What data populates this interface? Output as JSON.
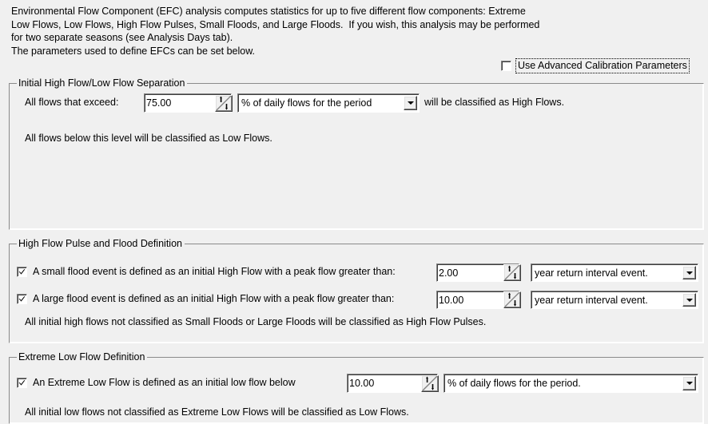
{
  "intro": {
    "text": "Environmental Flow Component (EFC) analysis computes statistics for up to five different flow components: Extreme\nLow Flows, Low Flows, High Flow Pulses, Small Floods, and Large Floods.  If you wish, this analysis may be performed\nfor two separate seasons (see Analysis Days tab).\nThe parameters used to define EFCs can be set below."
  },
  "advanced": {
    "label": "Use Advanced Calibration Parameters",
    "checked": false
  },
  "separation_group": {
    "title": "Initial High Flow/Low Flow Separation",
    "exceed_label": "All flows that exceed:",
    "exceed_value": "75.00",
    "exceed_unit": "% of daily flows for the period",
    "classified_label": "will be classified as High Flows.",
    "note": "All flows below this level will be classified as Low Flows."
  },
  "flood_group": {
    "title": "High Flow Pulse and Flood Definition",
    "small_flood_label": "A small flood event is defined as an initial High Flow with a peak flow greater than:",
    "small_flood_value": "2.00",
    "small_flood_unit": "year return interval event.",
    "large_flood_label": "A large flood event is defined as an initial High Flow with a peak flow greater than:",
    "large_flood_value": "10.00",
    "large_flood_unit": "year return interval event.",
    "note": "All initial high flows not classified as Small Floods or Large Floods will be classified as High Flow Pulses."
  },
  "extreme_group": {
    "title": "Extreme Low Flow Definition",
    "extreme_label": "An Extreme Low Flow is defined as an initial low flow below",
    "extreme_value": "10.00",
    "extreme_unit": "% of daily flows for the period.",
    "note": "All initial low flows not classified as Extreme Low Flows will be classified as Low Flows."
  },
  "icons": {
    "spinner": "spinner-up-down-icon",
    "dropdown": "chevron-down-icon",
    "checkmark": "checkmark-icon"
  },
  "colors": {
    "background": "#f0f0f0",
    "field": "#ffffff",
    "border": "#808080",
    "text": "#000000"
  }
}
